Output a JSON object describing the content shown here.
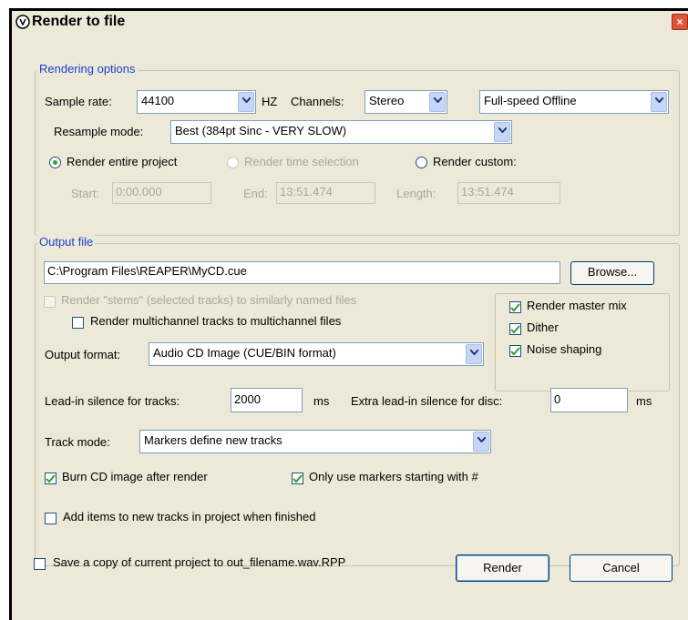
{
  "window": {
    "title": "Render to file",
    "close": "×"
  },
  "rendering_options": {
    "legend": "Rendering options",
    "sample_rate_label": "Sample rate:",
    "sample_rate_value": "44100",
    "hz_label": "HZ",
    "channels_label": "Channels:",
    "channels_value": "Stereo",
    "render_speed_value": "Full-speed Offline",
    "resample_label": "Resample mode:",
    "resample_value": "Best (384pt Sinc - VERY SLOW)",
    "radio_entire": "Render entire project",
    "radio_time_selection": "Render time selection",
    "radio_custom": "Render custom:",
    "selected_radio": "entire",
    "start_label": "Start:",
    "start_value": "0:00.000",
    "end_label": "End:",
    "end_value": "13:51.474",
    "length_label": "Length:",
    "length_value": "13:51.474"
  },
  "output_file": {
    "legend": "Output file",
    "path_value": "C:\\Program Files\\REAPER\\MyCD.cue",
    "browse_label": "Browse...",
    "stems_label": "Render \"stems\" (selected tracks) to similarly named files",
    "stems_checked": false,
    "multichannel_label": "Render multichannel tracks to multichannel files",
    "multichannel_checked": false,
    "master_mix_label": "Render master mix",
    "master_mix_checked": true,
    "dither_label": "Dither",
    "dither_checked": true,
    "noise_shaping_label": "Noise shaping",
    "noise_shaping_checked": true,
    "format_label": "Output format:",
    "format_value": "Audio CD Image (CUE/BIN format)",
    "leadin_label": "Lead-in silence for tracks:",
    "leadin_value": "2000",
    "leadin_unit": "ms",
    "extra_leadin_label": "Extra lead-in silence for disc:",
    "extra_leadin_value": "0",
    "extra_leadin_unit": "ms",
    "track_mode_label": "Track mode:",
    "track_mode_value": "Markers define new tracks",
    "burn_label": "Burn CD image after render",
    "burn_checked": true,
    "markers_hash_label": "Only use markers starting with #",
    "markers_hash_checked": true,
    "add_items_label": "Add items to new tracks in project when finished",
    "add_items_checked": false
  },
  "footer": {
    "save_copy_label": "Save a copy of current project to out_filename.wav.RPP",
    "save_copy_checked": false,
    "render_label": "Render",
    "cancel_label": "Cancel"
  },
  "colors": {
    "dialog_bg": "#ece9d8",
    "legend_text": "#1a3fd1",
    "check_mark": "#2ea02e",
    "close_button": "#e0553a"
  }
}
